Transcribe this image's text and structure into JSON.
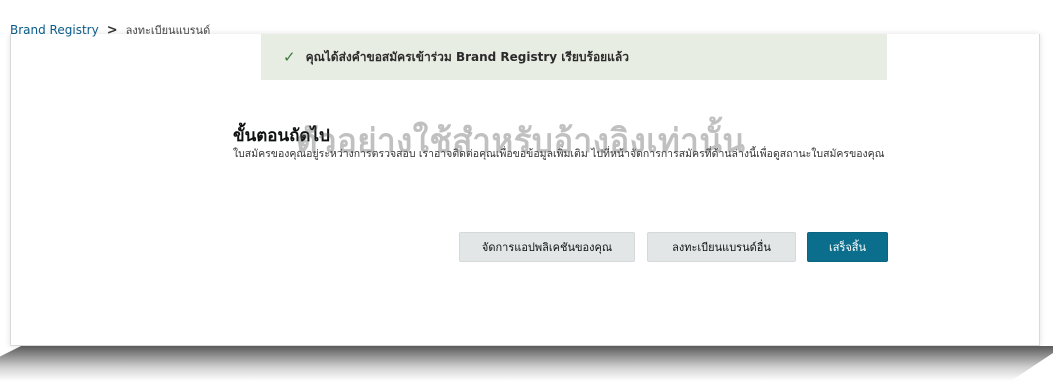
{
  "breadcrumb": {
    "root": "Brand Registry",
    "separator": ">",
    "current": "ลงทะเบียนแบรนด์"
  },
  "banner": {
    "icon": "checkmark-icon",
    "message": "คุณได้ส่งคำขอสมัครเข้าร่วม Brand Registry เรียบร้อยแล้ว"
  },
  "next_steps": {
    "title": "ขั้นตอนถัดไป",
    "watermark": "ตัวอย่างใช้สำหรับอ้างอิงเท่านั้น",
    "description": "ใบสมัครของคุณอยู่ระหว่างการตรวจสอบ เราอาจติดต่อคุณเพื่อขอข้อมูลเพิ่มเติม ไปที่หน้าจัดการการสมัครที่ด้านล่างนี้เพื่อดูสถานะใบสมัครของคุณ"
  },
  "actions": {
    "manage_label": "จัดการแอปพลิเคชันของคุณ",
    "register_other_label": "ลงทะเบียนแบรนด์อื่น",
    "done_label": "เสร็จสิ้น"
  },
  "colors": {
    "primary": "#0b6e8c",
    "banner_bg": "#e8ede3",
    "link": "#0a5b8a"
  }
}
